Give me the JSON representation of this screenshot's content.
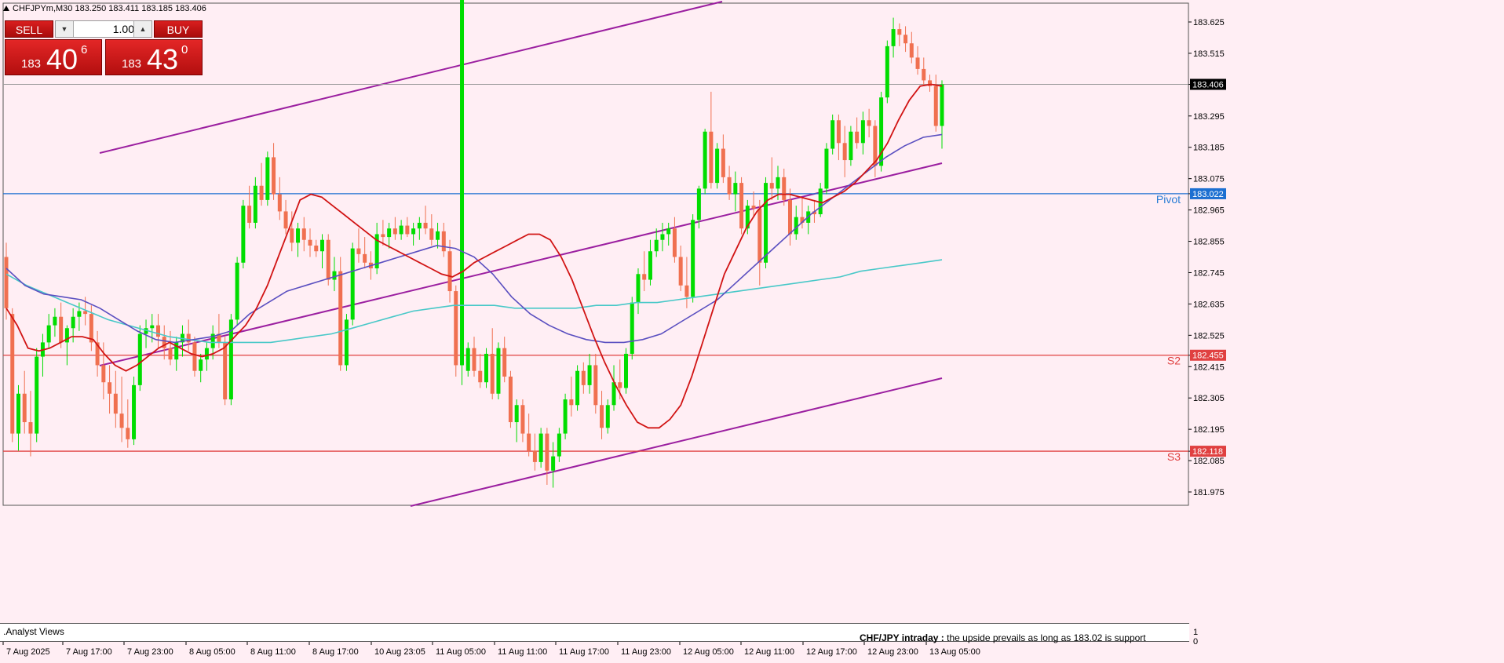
{
  "header": {
    "symbol_line": "CHFJPYm,M30  183.250 183.411 183.185 183.406",
    "menu_icon": "triangle-up-icon"
  },
  "trade_panel": {
    "sell_label": "SELL",
    "buy_label": "BUY",
    "lot": "1.00",
    "sell_quote": {
      "base": "183",
      "big": "40",
      "sup": "6"
    },
    "buy_quote": {
      "base": "183",
      "big": "43",
      "sup": "0"
    }
  },
  "price_axis": {
    "ticks": [
      "183.625",
      "183.515",
      "183.406",
      "183.295",
      "183.185",
      "183.075",
      "183.022",
      "182.965",
      "182.855",
      "182.745",
      "182.635",
      "182.525",
      "182.455",
      "182.415",
      "182.305",
      "182.195",
      "182.118",
      "182.085",
      "181.975"
    ],
    "current": "183.406"
  },
  "levels": [
    {
      "name": "Pivot",
      "price": 183.022,
      "tag": "183.022",
      "color": "#1c6fd1",
      "label_color": "#2d7fd6"
    },
    {
      "name": "S2",
      "price": 182.455,
      "tag": "182.455",
      "color": "#e04040",
      "label_color": "#e04040"
    },
    {
      "name": "S3",
      "price": 182.118,
      "tag": "182.118",
      "color": "#e04040",
      "label_color": "#e04040"
    }
  ],
  "time_axis": [
    "7 Aug 2025",
    "7 Aug 17:00",
    "7 Aug 23:00",
    "8 Aug 05:00",
    "8 Aug 11:00",
    "8 Aug 17:00",
    "10 Aug 23:05",
    "11 Aug 05:00",
    "11 Aug 11:00",
    "11 Aug 17:00",
    "11 Aug 23:00",
    "12 Aug 05:00",
    "12 Aug 11:00",
    "12 Aug 17:00",
    "12 Aug 23:00",
    "13 Aug 05:00"
  ],
  "indicator_window": {
    "label": ".Analyst Views",
    "message_bold": "CHF/JPY intraday :",
    "message": "  the upside prevails as long as 183.02 is support",
    "scale_top": "1",
    "scale_bottom": "0"
  },
  "colors": {
    "bull": "#00dd00",
    "bear": "#f07050",
    "background": "#ffeef4",
    "channel": "#9b1fa0",
    "ma_fast": "#d11414",
    "ma_mid": "#5a4fc0",
    "ma_slow": "#48c8c8"
  },
  "chart_data": {
    "type": "candlestick",
    "symbol": "CHFJPYm",
    "timeframe": "M30",
    "ylim": [
      181.93,
      183.7
    ],
    "candles": [
      [
        182.8,
        182.85,
        182.58,
        182.62
      ],
      [
        182.6,
        182.62,
        182.15,
        182.18
      ],
      [
        182.18,
        182.35,
        182.12,
        182.32
      ],
      [
        182.32,
        182.4,
        182.18,
        182.22
      ],
      [
        182.22,
        182.33,
        182.1,
        182.18
      ],
      [
        182.18,
        182.48,
        182.15,
        182.45
      ],
      [
        182.45,
        182.53,
        182.38,
        182.5
      ],
      [
        182.5,
        182.6,
        182.48,
        182.56
      ],
      [
        182.56,
        182.62,
        182.52,
        182.59
      ],
      [
        182.59,
        182.64,
        182.48,
        182.5
      ],
      [
        182.5,
        182.56,
        182.42,
        182.55
      ],
      [
        182.55,
        182.62,
        182.5,
        182.59
      ],
      [
        182.59,
        182.64,
        182.54,
        182.61
      ],
      [
        182.61,
        182.66,
        182.56,
        182.6
      ],
      [
        182.6,
        182.63,
        182.47,
        182.5
      ],
      [
        182.5,
        182.54,
        182.38,
        182.42
      ],
      [
        182.42,
        182.5,
        182.3,
        182.36
      ],
      [
        182.36,
        182.42,
        182.25,
        182.32
      ],
      [
        182.32,
        182.4,
        182.2,
        182.25
      ],
      [
        182.25,
        182.38,
        182.15,
        182.2
      ],
      [
        182.2,
        182.3,
        182.13,
        182.16
      ],
      [
        182.16,
        182.38,
        182.14,
        182.35
      ],
      [
        182.35,
        182.56,
        182.33,
        182.53
      ],
      [
        182.53,
        182.58,
        182.48,
        182.55
      ],
      [
        182.55,
        182.6,
        182.5,
        182.56
      ],
      [
        182.56,
        182.6,
        182.48,
        182.52
      ],
      [
        182.52,
        182.56,
        182.44,
        182.48
      ],
      [
        182.48,
        182.54,
        182.42,
        182.44
      ],
      [
        182.44,
        182.52,
        182.4,
        182.5
      ],
      [
        182.5,
        182.56,
        182.45,
        182.53
      ],
      [
        182.53,
        182.58,
        182.47,
        182.5
      ],
      [
        182.5,
        182.52,
        182.38,
        182.4
      ],
      [
        182.4,
        182.46,
        182.36,
        182.44
      ],
      [
        182.44,
        182.5,
        182.4,
        182.48
      ],
      [
        182.48,
        182.56,
        182.44,
        182.53
      ],
      [
        182.53,
        182.6,
        182.48,
        182.5
      ],
      [
        182.5,
        182.52,
        182.28,
        182.3
      ],
      [
        182.3,
        182.6,
        182.28,
        182.58
      ],
      [
        182.58,
        182.8,
        182.56,
        182.78
      ],
      [
        182.78,
        183.0,
        182.76,
        182.98
      ],
      [
        182.98,
        183.05,
        182.9,
        182.92
      ],
      [
        182.92,
        183.08,
        182.9,
        183.05
      ],
      [
        183.05,
        183.13,
        182.98,
        183.0
      ],
      [
        183.0,
        183.17,
        182.98,
        183.15
      ],
      [
        183.15,
        183.2,
        183.0,
        183.02
      ],
      [
        183.02,
        183.08,
        182.93,
        182.96
      ],
      [
        182.96,
        183.0,
        182.88,
        182.9
      ],
      [
        182.9,
        182.96,
        182.82,
        182.85
      ],
      [
        182.85,
        182.92,
        182.8,
        182.9
      ],
      [
        182.9,
        182.94,
        182.82,
        182.86
      ],
      [
        182.86,
        182.9,
        182.8,
        182.84
      ],
      [
        182.84,
        182.86,
        182.8,
        182.82
      ],
      [
        182.82,
        182.88,
        182.76,
        182.86
      ],
      [
        182.86,
        182.88,
        182.7,
        182.72
      ],
      [
        182.72,
        182.8,
        182.68,
        182.75
      ],
      [
        182.75,
        182.8,
        182.4,
        182.42
      ],
      [
        182.42,
        182.6,
        182.4,
        182.58
      ],
      [
        182.58,
        182.85,
        182.56,
        182.83
      ],
      [
        182.83,
        182.9,
        182.78,
        182.81
      ],
      [
        182.81,
        182.87,
        182.76,
        182.78
      ],
      [
        182.78,
        182.82,
        182.72,
        182.76
      ],
      [
        182.76,
        182.92,
        182.74,
        182.88
      ],
      [
        182.88,
        182.93,
        182.84,
        182.87
      ],
      [
        182.87,
        182.92,
        182.83,
        182.9
      ],
      [
        182.9,
        182.94,
        182.86,
        182.88
      ],
      [
        182.88,
        182.93,
        182.86,
        182.91
      ],
      [
        182.91,
        182.94,
        182.87,
        182.88
      ],
      [
        182.88,
        182.92,
        182.84,
        182.9
      ],
      [
        182.9,
        182.94,
        182.86,
        182.92
      ],
      [
        182.92,
        182.98,
        182.88,
        182.9
      ],
      [
        182.9,
        182.95,
        182.84,
        182.86
      ],
      [
        182.86,
        182.92,
        182.83,
        182.89
      ],
      [
        182.89,
        182.92,
        182.8,
        182.82
      ],
      [
        182.82,
        182.86,
        182.64,
        182.68
      ],
      [
        182.68,
        182.7,
        182.38,
        182.42
      ],
      [
        182.42,
        182.5,
        182.35,
        382.4
      ],
      [
        182.4,
        182.5,
        182.38,
        182.48
      ],
      [
        182.48,
        182.52,
        182.38,
        182.4
      ],
      [
        182.4,
        182.46,
        182.34,
        182.36
      ],
      [
        182.36,
        182.48,
        182.34,
        182.46
      ],
      [
        182.46,
        182.55,
        182.3,
        182.32
      ],
      [
        182.32,
        182.5,
        182.3,
        182.48
      ],
      [
        182.48,
        182.52,
        182.36,
        182.38
      ],
      [
        182.38,
        182.4,
        182.2,
        182.22
      ],
      [
        182.22,
        182.3,
        182.15,
        182.28
      ],
      [
        182.28,
        182.3,
        182.15,
        182.18
      ],
      [
        182.18,
        182.25,
        182.1,
        182.12
      ],
      [
        182.12,
        182.18,
        182.05,
        182.08
      ],
      [
        182.08,
        182.2,
        182.06,
        182.18
      ],
      [
        182.18,
        182.2,
        182.0,
        182.05
      ],
      [
        182.05,
        182.15,
        181.99,
        182.1
      ],
      [
        182.1,
        182.2,
        182.08,
        182.18
      ],
      [
        182.18,
        182.32,
        182.16,
        182.3
      ],
      [
        182.3,
        182.38,
        182.24,
        182.28
      ],
      [
        182.28,
        182.42,
        182.26,
        182.4
      ],
      [
        182.4,
        182.43,
        182.32,
        182.35
      ],
      [
        182.35,
        182.46,
        182.32,
        182.42
      ],
      [
        182.42,
        182.46,
        182.25,
        182.28
      ],
      [
        182.28,
        182.33,
        182.16,
        182.2
      ],
      [
        182.2,
        182.3,
        182.18,
        182.28
      ],
      [
        182.28,
        182.42,
        182.26,
        182.36
      ],
      [
        182.36,
        182.44,
        182.3,
        182.34
      ],
      [
        182.34,
        182.48,
        182.32,
        182.46
      ],
      [
        182.46,
        182.66,
        182.44,
        182.64
      ],
      [
        182.64,
        182.76,
        182.6,
        182.74
      ],
      [
        182.74,
        182.82,
        182.68,
        182.72
      ],
      [
        182.72,
        182.86,
        182.7,
        182.82
      ],
      [
        182.82,
        182.9,
        182.8,
        182.86
      ],
      [
        182.86,
        182.92,
        182.82,
        182.88
      ],
      [
        182.88,
        182.92,
        182.84,
        182.9
      ],
      [
        182.9,
        182.94,
        182.78,
        182.8
      ],
      [
        182.8,
        182.84,
        182.68,
        182.7
      ],
      [
        182.7,
        182.8,
        182.62,
        182.66
      ],
      [
        182.66,
        182.95,
        182.64,
        182.93
      ],
      [
        182.93,
        183.05,
        182.9,
        183.04
      ],
      [
        183.04,
        183.25,
        183.02,
        183.24
      ],
      [
        183.24,
        183.38,
        183.04,
        183.06
      ],
      [
        183.06,
        183.2,
        183.04,
        183.18
      ],
      [
        183.18,
        183.23,
        183.06,
        183.08
      ],
      [
        183.08,
        183.12,
        183.0,
        183.02
      ],
      [
        183.02,
        183.1,
        182.96,
        183.06
      ],
      [
        183.06,
        183.08,
        182.88,
        182.9
      ],
      [
        182.9,
        183.0,
        182.88,
        182.98
      ],
      [
        182.98,
        183.03,
        182.94,
        182.97
      ],
      [
        182.97,
        183.0,
        182.7,
        182.78
      ],
      [
        182.78,
        183.08,
        182.76,
        183.06
      ],
      [
        183.06,
        183.15,
        183.0,
        183.04
      ],
      [
        183.04,
        183.12,
        183.0,
        183.08
      ],
      [
        183.08,
        183.11,
        182.98,
        183.0
      ],
      [
        183.0,
        183.04,
        182.84,
        182.88
      ],
      [
        182.88,
        182.98,
        182.86,
        182.94
      ],
      [
        182.94,
        183.01,
        182.9,
        182.92
      ],
      [
        182.92,
        182.98,
        182.88,
        182.96
      ],
      [
        182.96,
        183.0,
        182.92,
        182.95
      ],
      [
        182.95,
        183.06,
        182.94,
        183.04
      ],
      [
        183.04,
        183.2,
        183.02,
        183.18
      ],
      [
        183.18,
        183.3,
        183.16,
        183.28
      ],
      [
        183.28,
        183.3,
        183.14,
        183.2
      ],
      [
        183.2,
        183.26,
        183.08,
        183.14
      ],
      [
        183.14,
        183.26,
        183.12,
        183.24
      ],
      [
        183.24,
        183.29,
        183.18,
        183.2
      ],
      [
        183.2,
        183.31,
        183.16,
        183.28
      ],
      [
        183.28,
        183.32,
        183.22,
        183.26
      ],
      [
        183.26,
        183.28,
        183.08,
        183.12
      ],
      [
        183.12,
        183.38,
        183.1,
        183.36
      ],
      [
        183.36,
        183.56,
        183.34,
        183.54
      ],
      [
        183.54,
        183.64,
        183.5,
        183.6
      ],
      [
        183.6,
        183.62,
        183.54,
        183.58
      ],
      [
        183.58,
        183.61,
        183.52,
        183.55
      ],
      [
        183.55,
        183.59,
        183.48,
        183.5
      ],
      [
        183.5,
        183.54,
        183.44,
        183.46
      ],
      [
        183.46,
        183.5,
        183.4,
        183.42
      ],
      [
        183.42,
        183.44,
        183.38,
        183.4
      ],
      [
        183.4,
        183.44,
        183.24,
        183.26
      ],
      [
        183.26,
        183.42,
        183.18,
        183.406
      ]
    ],
    "ma_fast": [
      182.62,
      182.56,
      182.48,
      182.47,
      182.48,
      182.5,
      182.52,
      182.52,
      182.51,
      182.46,
      182.42,
      182.4,
      182.42,
      182.45,
      182.48,
      182.5,
      182.48,
      182.46,
      182.45,
      182.46,
      182.48,
      182.52,
      182.56,
      182.62,
      182.7,
      182.8,
      182.9,
      183.0,
      183.02,
      183.01,
      182.98,
      182.95,
      182.92,
      182.89,
      182.86,
      182.84,
      182.82,
      182.8,
      182.78,
      182.76,
      182.74,
      182.73,
      182.75,
      182.78,
      182.8,
      182.82,
      182.84,
      182.86,
      182.88,
      182.88,
      182.86,
      182.8,
      182.72,
      182.62,
      182.52,
      182.43,
      182.35,
      182.28,
      182.22,
      182.2,
      182.2,
      182.23,
      182.28,
      182.38,
      182.5,
      182.62,
      182.74,
      182.82,
      182.9,
      182.96,
      183.0,
      183.02,
      183.02,
      183.01,
      183.0,
      182.99,
      183.01,
      183.03,
      183.06,
      183.1,
      183.14,
      183.2,
      183.28,
      183.35,
      183.4,
      183.406,
      183.4
    ],
    "ma_mid": [
      182.76,
      182.7,
      182.67,
      182.66,
      182.65,
      182.62,
      182.58,
      182.54,
      182.51,
      182.5,
      182.51,
      182.52,
      182.54,
      182.6,
      182.64,
      182.68,
      182.7,
      182.72,
      182.74,
      182.76,
      182.78,
      182.8,
      182.82,
      182.84,
      182.83,
      182.8,
      182.74,
      182.66,
      182.6,
      182.56,
      182.53,
      182.51,
      182.5,
      182.5,
      182.51,
      182.53,
      182.57,
      182.61,
      182.65,
      182.71,
      182.77,
      182.83,
      182.89,
      182.95,
      183.0,
      183.05,
      183.1,
      183.15,
      183.19,
      183.22,
      183.23
    ],
    "ma_slow": [
      182.74,
      182.7,
      182.67,
      182.64,
      182.61,
      182.58,
      182.56,
      182.54,
      182.52,
      182.51,
      182.5,
      182.5,
      182.5,
      182.5,
      182.51,
      182.52,
      182.53,
      182.55,
      182.57,
      182.59,
      182.61,
      182.62,
      182.63,
      182.63,
      182.63,
      182.62,
      182.62,
      182.62,
      182.62,
      182.63,
      182.63,
      182.64,
      182.64,
      182.65,
      182.66,
      182.67,
      182.68,
      182.69,
      182.7,
      182.71,
      182.72,
      182.73,
      182.75,
      182.76,
      182.77,
      182.78,
      182.79
    ]
  }
}
